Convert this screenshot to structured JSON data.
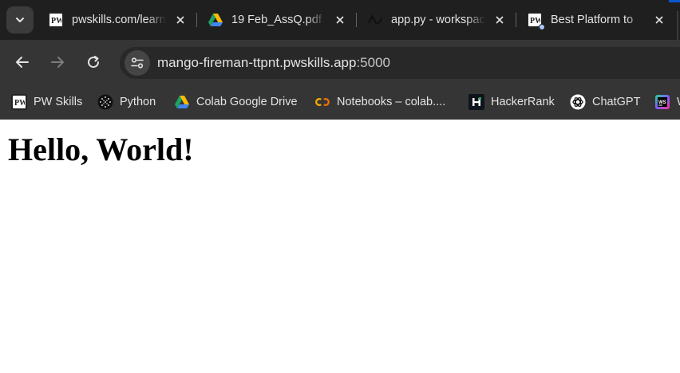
{
  "tabs": [
    {
      "title": "pwskills.com/learn",
      "icon": "pw-skills-icon",
      "close": "✕"
    },
    {
      "title": "19 Feb_AssQ.pdf",
      "icon": "google-drive-icon",
      "close": "✕"
    },
    {
      "title": "app.py - workspace",
      "icon": "workspace-icon",
      "close": "✕"
    },
    {
      "title": "Best Platform to",
      "icon": "pw-skills-icon",
      "close": "✕"
    }
  ],
  "toolbar": {
    "url_host": "mango-fireman-ttpnt.pwskills.app",
    "url_port": ":5000"
  },
  "bookmarks": [
    {
      "label": "PW Skills",
      "icon": "pw-skills-icon"
    },
    {
      "label": "Python",
      "icon": "python-icon"
    },
    {
      "label": "Colab Google Drive",
      "icon": "google-drive-icon"
    },
    {
      "label": "Notebooks – colab....",
      "icon": "colab-icon"
    },
    {
      "label": "HackerRank",
      "icon": "hackerrank-icon"
    },
    {
      "label": "ChatGPT",
      "icon": "chatgpt-icon"
    },
    {
      "label": "W",
      "icon": "webstorm-icon"
    }
  ],
  "page": {
    "heading": "Hello, World!"
  },
  "colors": {
    "tabstrip_bg": "#1f1f1f",
    "toolbar_bg": "#353535",
    "omnibox_bg": "#282828",
    "text_light": "#e3e3e3",
    "accent": "#0b57d0",
    "page_bg": "#ffffff"
  }
}
